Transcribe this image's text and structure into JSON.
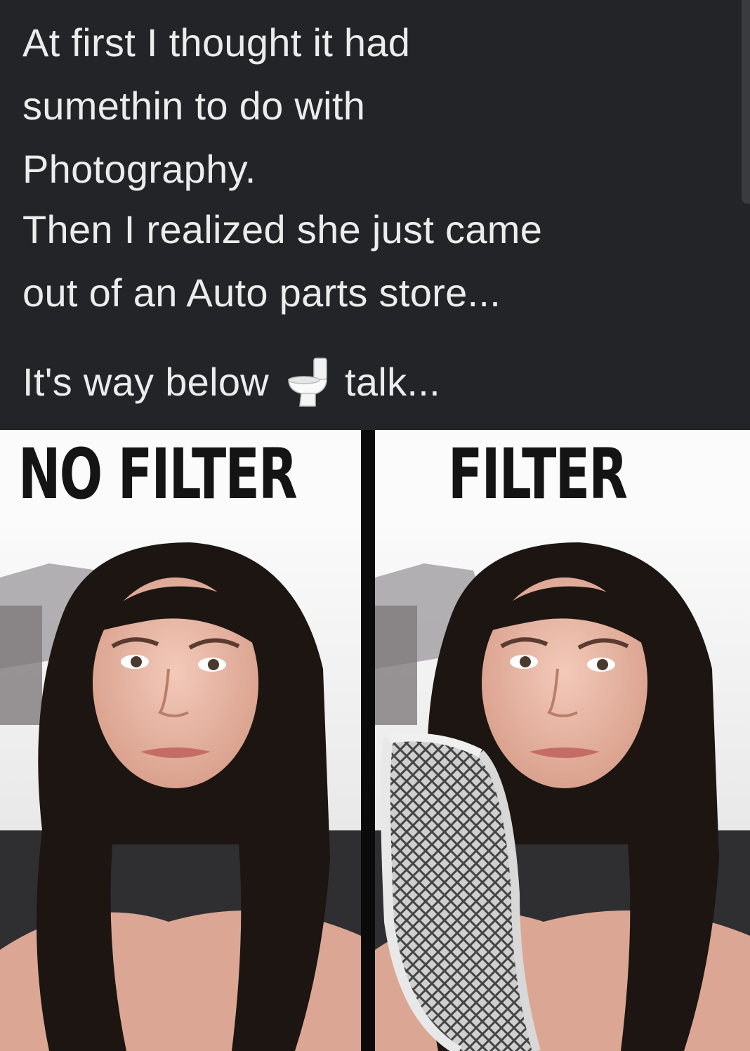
{
  "post": {
    "caption_lines": [
      "At first I thought it had",
      "sumethin to do with",
      "Photography.",
      "Then I realized she just came",
      "out of an Auto parts store..."
    ],
    "joke_before": "It's way below",
    "joke_emoji": "toilet-emoji",
    "joke_after": "talk..."
  },
  "meme": {
    "left_label": "NO FILTER",
    "right_label": "FILTER"
  },
  "colors": {
    "post_background": "#232427",
    "caption_text": "#ececec",
    "divider": "#0b0b0b",
    "hair": "#1c1512",
    "skin": "#e9b9a8"
  }
}
